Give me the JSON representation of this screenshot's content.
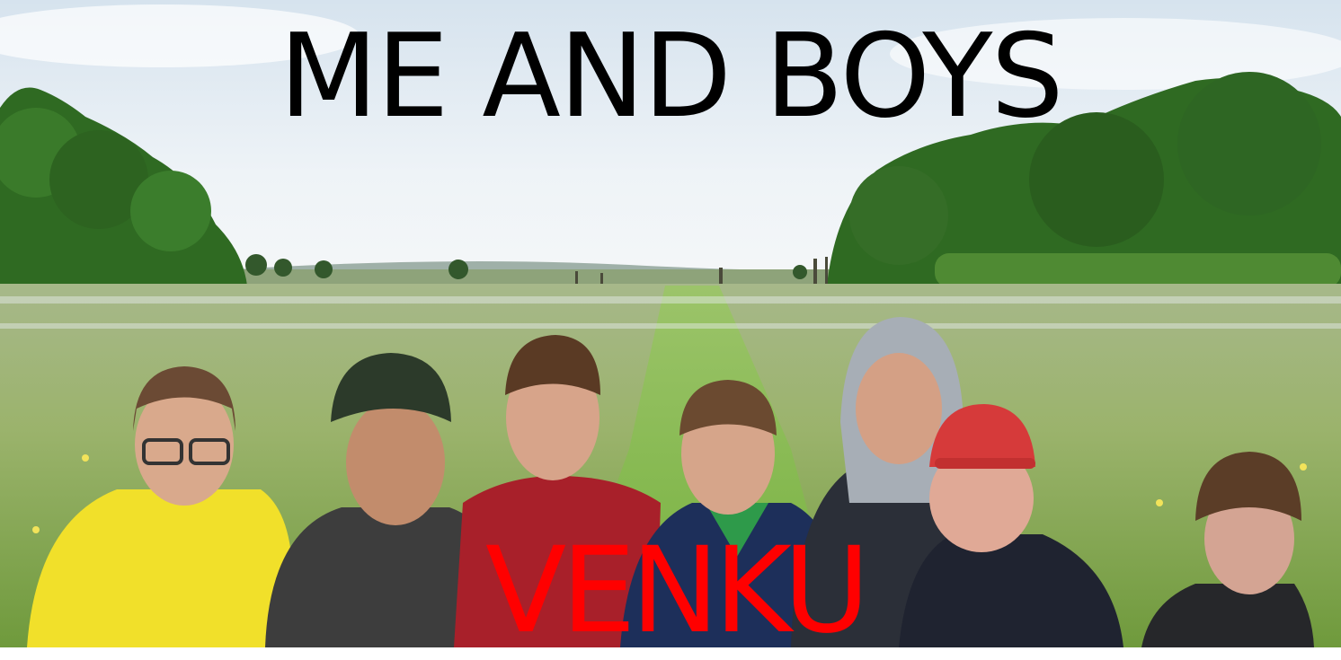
{
  "meme": {
    "top_text": "ME AND BOYS",
    "bottom_text": "VENKU",
    "top_text_color": "#000000",
    "bottom_text_color": "#ff0000"
  },
  "scene": {
    "sky_color": "#eef3f7",
    "meadow_color": "#8fae5a",
    "path_color": "#7fb64a",
    "tree_color": "#2f6a22",
    "people_count": 7
  }
}
